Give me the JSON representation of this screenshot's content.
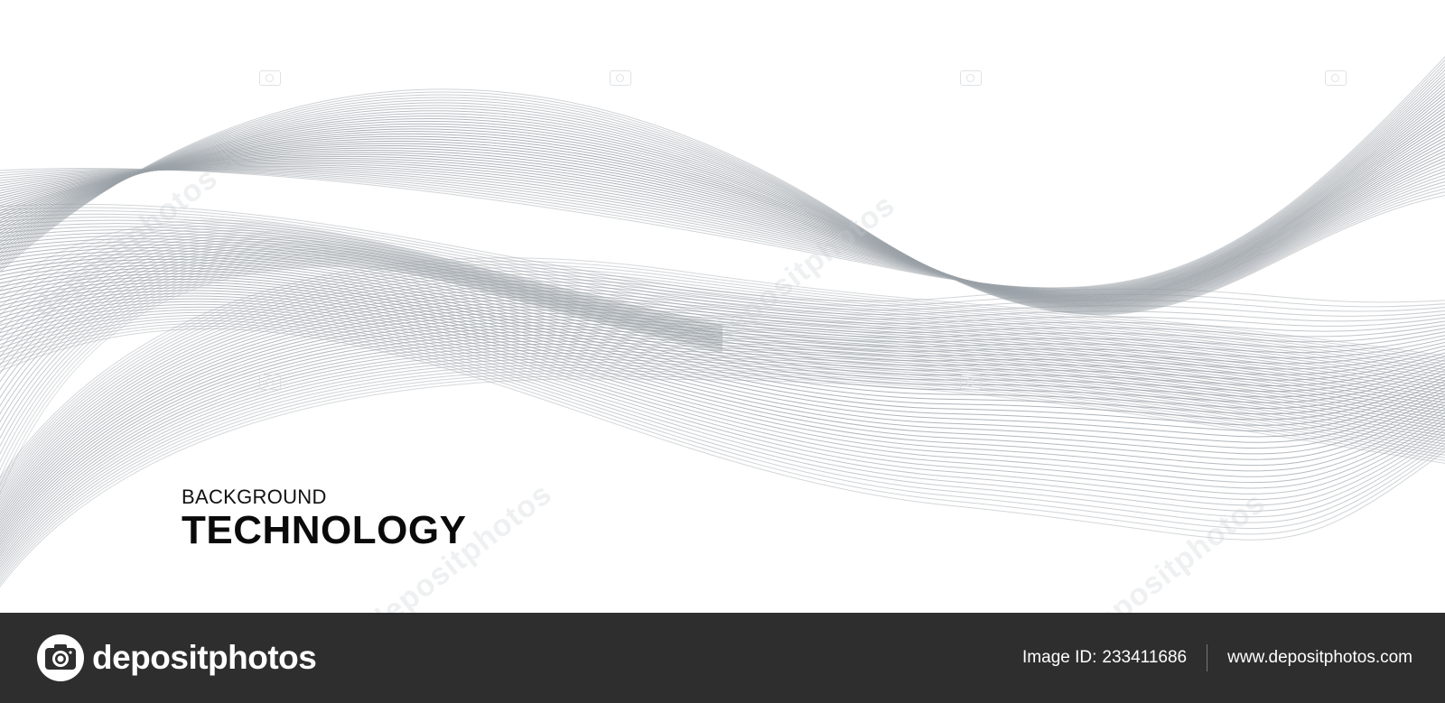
{
  "headline": {
    "small": "BACKGROUND",
    "big": "TECHNOLOGY"
  },
  "watermark": {
    "text": "depositphotos"
  },
  "footer": {
    "logo_text": "depositphotos",
    "logo_icon": "camera-icon",
    "image_id_label": "Image ID:",
    "image_id": "233411686",
    "url": "www.depositphotos.com"
  },
  "colors": {
    "wave_line": "#9aa1a7",
    "footer_bg": "#2e2e2e",
    "text": "#0a0a0a"
  }
}
